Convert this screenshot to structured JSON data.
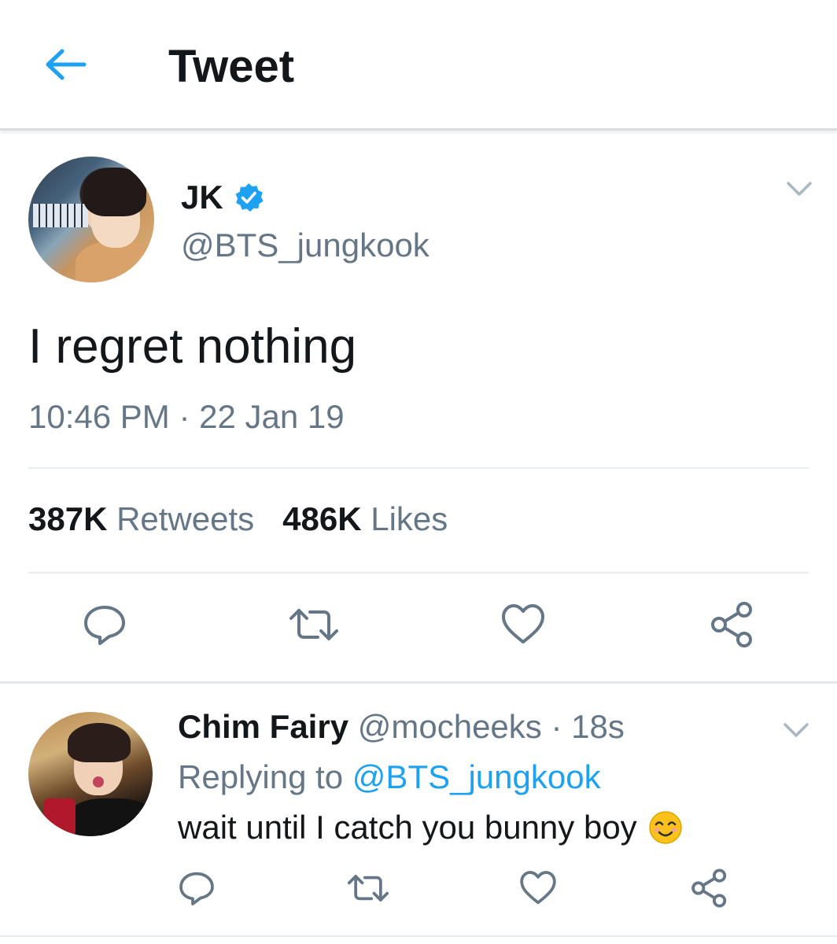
{
  "app_bar": {
    "title": "Tweet",
    "back_icon": "arrow-left-icon"
  },
  "colors": {
    "accent": "#1da1f2",
    "text_primary": "#14171a",
    "text_secondary": "#657786",
    "divider": "#e6ecf0",
    "action_icon": "#657786"
  },
  "main_tweet": {
    "display_name": "JK",
    "verified": true,
    "handle": "@BTS_jungkook",
    "text": "I regret nothing",
    "timestamp": "10:46 PM · 22 Jan 19",
    "stats": {
      "retweets_count": "387K",
      "retweets_label": "Retweets",
      "likes_count": "486K",
      "likes_label": "Likes"
    },
    "actions": [
      "reply-icon",
      "retweet-icon",
      "like-icon",
      "share-icon"
    ]
  },
  "reply": {
    "display_name": "Chim Fairy",
    "handle": "@mocheeks",
    "time": "18s",
    "replying_label": "Replying to",
    "replying_to": "@BTS_jungkook",
    "text": "wait until I catch you bunny boy",
    "emoji": "smiling-face-emoji",
    "actions": [
      "reply-icon",
      "retweet-icon",
      "like-icon",
      "share-icon"
    ]
  }
}
